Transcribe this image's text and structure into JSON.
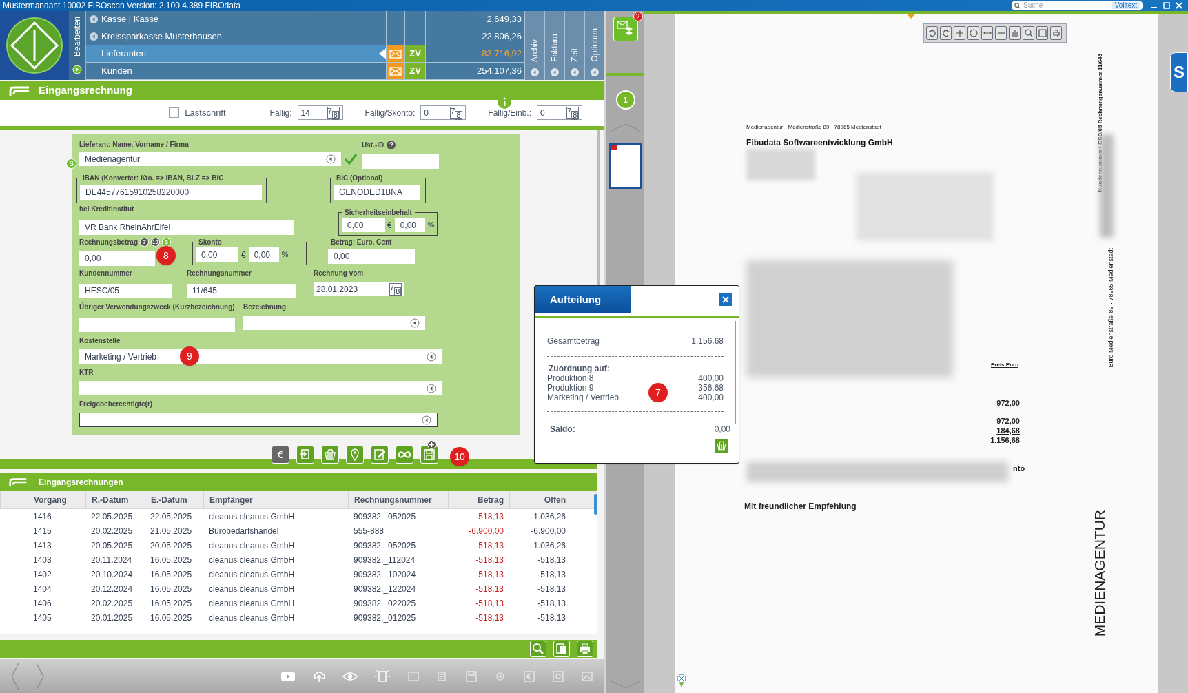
{
  "title_bar": {
    "title": "Mustermandant 10002 FIBOscan Version: 2.100.4.389 FIBOdata",
    "search_placeholder": "Suche",
    "search_mode": "Volltext"
  },
  "side_label": "Bearbeiten",
  "accounts": [
    {
      "name": "Kasse | Kasse",
      "has_arrow": true,
      "selected": false,
      "mail": false,
      "amount": "2.649,33",
      "negative": false
    },
    {
      "name": "Kreissparkasse Musterhausen",
      "has_arrow": true,
      "selected": false,
      "mail": false,
      "amount": "22.806,26",
      "negative": false
    },
    {
      "name": "Lieferanten",
      "has_arrow": false,
      "selected": true,
      "mail": true,
      "zv": "ZV",
      "amount": "-83.716,92",
      "negative": true
    },
    {
      "name": "Kunden",
      "has_arrow": false,
      "selected": false,
      "mail": true,
      "zv": "ZV",
      "amount": "254.107,36",
      "negative": false
    }
  ],
  "vertical_tabs": [
    "Archiv",
    "Faktura",
    "Zeit",
    "Optionen"
  ],
  "form_title": "Eingangsrechnung",
  "lastschrift": {
    "label": "Lastschrift",
    "checked": false
  },
  "due_fields": [
    {
      "label": "Fällig:",
      "value": "14",
      "calendar": [
        "7",
        "8"
      ]
    },
    {
      "label": "Fällig/Skonto:",
      "value": "0",
      "calendar": [
        "7",
        "8"
      ]
    },
    {
      "label": "Fällig/Einb.:",
      "value": "0",
      "calendar": [
        "7",
        "8"
      ]
    }
  ],
  "form": {
    "supplier": {
      "label": "Lieferant: Name, Vorname / Firma",
      "value": "Medienagentur",
      "status": "S",
      "verified": true
    },
    "vat_id": {
      "label": "Ust.-ID",
      "help": "?"
    },
    "iban": {
      "label": "IBAN (Konverter: Kto. => IBAN, BLZ => BIC",
      "value": "DE44577615910258220000"
    },
    "bic": {
      "label": "BIC (Optional)",
      "value": "GENODED1BNA"
    },
    "bank": {
      "label": "bei Kreditinstitut",
      "value": "VR Bank RheinAhrEifel"
    },
    "retention": {
      "label": "Sicherheitseinbehalt",
      "amount": "0,00",
      "currency": "€",
      "percent": "0,00",
      "percent_sign": "%"
    },
    "invoice_amount": {
      "label": "Rechnungsbetrag",
      "tax_badges": [
        "7",
        "19",
        "$"
      ],
      "value": "0,00",
      "marker": "8"
    },
    "skonto": {
      "label": "Skonto",
      "amount": "0,00",
      "currency": "€",
      "percent": "0,00",
      "percent_sign": "%"
    },
    "amount_cent": {
      "label": "Betrag: Euro, Cent",
      "value": "0,00"
    },
    "customer_no": {
      "label": "Kundennummer",
      "value": "HESC/05"
    },
    "invoice_no": {
      "label": "Rechnungsnummer",
      "value": "11/645"
    },
    "invoice_date": {
      "label": "Rechnung vom",
      "value": "28.01.2023",
      "calendar": [
        "7",
        "8"
      ]
    },
    "purpose": {
      "label": "Übriger Verwendungszweck (Kurzbezeichnung)"
    },
    "designation": {
      "label": "Bezeichnung"
    },
    "cost_center": {
      "label": "Kostenstelle",
      "value": "Marketing / Vertrieb",
      "marker": "9"
    },
    "ktr": {
      "label": "KTR"
    },
    "approver": {
      "label": "Freigabeberechtigte(r)"
    }
  },
  "toolbar": {
    "currency_symbol": "€",
    "marker": "10"
  },
  "list_title": "Eingangsrechnungen",
  "table": {
    "columns": [
      "Vorgang",
      "R.-Datum",
      "E.-Datum",
      "Empfänger",
      "Rechnungsnummer",
      "Betrag",
      "Offen"
    ],
    "rows": [
      [
        "1416",
        "22.05.2025",
        "22.05.2025",
        "cleanus cleanus GmbH",
        "909382._052025",
        "-518,13",
        "-1.036,26"
      ],
      [
        "1415",
        "20.02.2025",
        "21.05.2025",
        "Bürobedarfshandel",
        "555-888",
        "-6.900,00",
        "-6.900,00"
      ],
      [
        "1413",
        "20.05.2025",
        "20.05.2025",
        "cleanus cleanus GmbH",
        "909382._052025",
        "-518,13",
        "-1.036,26"
      ],
      [
        "1403",
        "20.11.2024",
        "16.05.2025",
        "cleanus cleanus GmbH",
        "909382._112024",
        "-518,13",
        "-518,13"
      ],
      [
        "1402",
        "20.10.2024",
        "16.05.2025",
        "cleanus cleanus GmbH",
        "909382._102024",
        "-518,13",
        "-518,13"
      ],
      [
        "1404",
        "20.12.2024",
        "16.05.2025",
        "cleanus cleanus GmbH",
        "909382._122024",
        "-518,13",
        "-518,13"
      ],
      [
        "1406",
        "20.02.2025",
        "16.05.2025",
        "cleanus cleanus GmbH",
        "909382._022025",
        "-518,13",
        "-518,13"
      ],
      [
        "1405",
        "20.01.2025",
        "16.05.2025",
        "cleanus cleanus GmbH",
        "909382._012025",
        "-518,13",
        "-518,13"
      ]
    ]
  },
  "inbox_badge": "2",
  "page_number": "1",
  "document": {
    "sender_line": "Medienagentur · Medienstraße 89 · 78965 Medienstadt",
    "recipient": "Fibudata Softwareentwicklung GmbH",
    "price_header": "Preis Euro",
    "amounts": [
      "972,00",
      "972,00",
      "184,68",
      "1.156,68"
    ],
    "fragment": "nto",
    "closing": "Mit freundlicher Empfehlung",
    "side_top": "Kundennummer HESC/05 Rechnungsnummer 11/645",
    "side_mid": "Büro Medienstraße 89 · 78965 Medienstadt",
    "brand": "MEDIENAGENTUR"
  },
  "side_tab": "S",
  "popup": {
    "title": "Aufteilung",
    "total_label": "Gesamtbetrag",
    "total": "1.156,68",
    "assign_label": "Zuordnung auf:",
    "items": [
      {
        "name": "Produktion 8",
        "amount": "400,00"
      },
      {
        "name": "Produktion 9",
        "amount": "356,68"
      },
      {
        "name": "Marketing / Vertrieb",
        "amount": "400,00"
      }
    ],
    "marker": "7",
    "balance_label": "Saldo:",
    "balance": "0,00"
  }
}
